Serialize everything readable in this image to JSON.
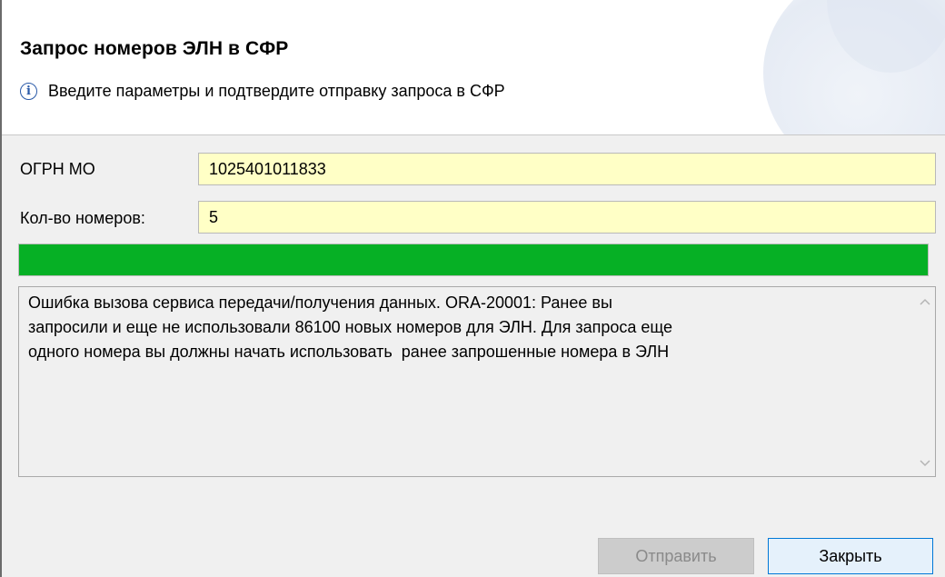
{
  "dialog": {
    "title": "Запрос номеров ЭЛН в СФР",
    "info_icon": "info-icon",
    "info_text": "Введите параметры и подтвердите отправку запроса в СФР"
  },
  "form": {
    "ogrn_label": "ОГРН МО",
    "ogrn_value": "1025401011833",
    "count_label": "Кол-во номеров:",
    "count_value": "5"
  },
  "progress": {
    "value_percent": 100,
    "color": "#06b025"
  },
  "message": {
    "text": "Ошибка вызова сервиса передачи/получения данных. ORA-20001: Ранее вы\nзапросили и еще не использовали 86100 новых номеров для ЭЛН. Для запроса еще\nодного номера вы должны начать использовать  ранее запрошенные номера в ЭЛН"
  },
  "buttons": {
    "send_label": "Отправить",
    "send_enabled": false,
    "close_label": "Закрыть"
  },
  "colors": {
    "field_background": "#ffffc6",
    "focus_border": "#0078d7"
  }
}
